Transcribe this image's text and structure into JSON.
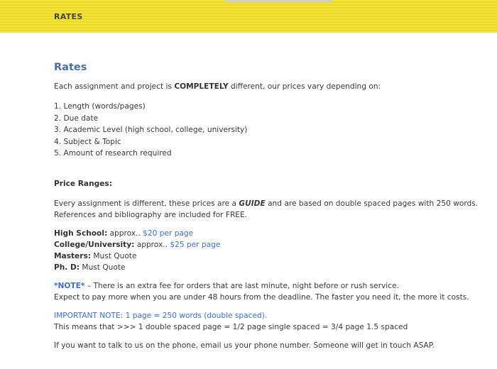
{
  "header": {
    "title": "RATES"
  },
  "main": {
    "heading": "Rates",
    "intro_prefix": "Each assignment and project is ",
    "intro_emphasis": "COMPLETELY",
    "intro_suffix": " different, our prices vary depending on:",
    "factors": [
      "1. Length (words/pages)",
      "2. Due date",
      "3. Academic Level (high school, college, university)",
      "4. Subject & Topic",
      "5. Amount of research required"
    ],
    "price_ranges_heading": "Price Ranges:",
    "guide_prefix": "Every assignment is different, these prices are a ",
    "guide_emphasis": "GUIDE",
    "guide_suffix": " and are based on double spaced pages with 250 words.",
    "guide_line2": "References and bibliography are included for FREE.",
    "levels": [
      {
        "label": "High School:",
        "approx": "  approx.. ",
        "price": "$20 per page"
      },
      {
        "label": "College/University:",
        "approx": "  approx.. ",
        "price": "$25 per page"
      },
      {
        "label": "Masters:",
        "approx": " Must Quote",
        "price": ""
      },
      {
        "label": "Ph. D:",
        "approx": " Must Quote",
        "price": ""
      }
    ],
    "note_label": "*NOTE*",
    "note_text": " – There is an extra fee for orders that are last minute, night before or rush service.",
    "note_line2": "Expect to pay more when you are under 48 hours from the deadline.  The faster you need it, the more it costs.",
    "important_note": "IMPORTANT NOTE: 1 page = 250 words (double spaced).",
    "spacing_line": "This means that >>> 1 double spaced page = 1/2 page single spaced = 3/4 page 1.5 spaced",
    "contact_line": "If you want to talk to us on the phone, email us your phone number. Someone will get in touch ASAP."
  },
  "colors": {
    "header_bg": "#f2e33a",
    "heading": "#4a6fa5",
    "link_blue": "#3b6fd4",
    "text": "#3a3a3a"
  }
}
